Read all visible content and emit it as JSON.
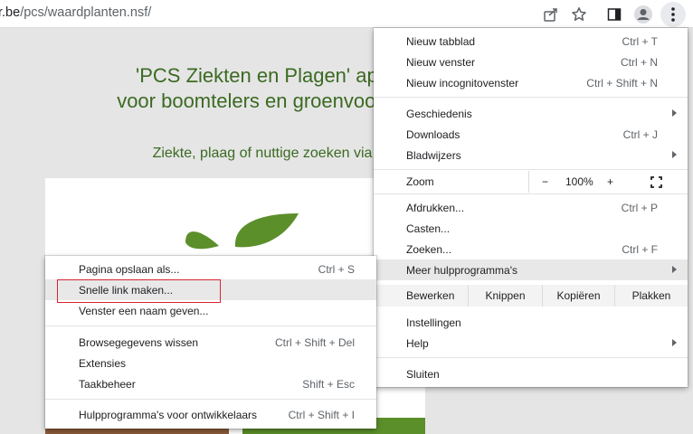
{
  "browser": {
    "url_domain": "r.be",
    "url_path": "/pcs/waardplanten.nsf/",
    "icons": [
      "share-icon",
      "bookmark-star-icon",
      "side-panel-icon",
      "profile-icon",
      "kebab-menu-icon"
    ]
  },
  "page": {
    "title_line1": "'PCS Ziekten en Plagen' app",
    "title_line2": "voor boomtelers en groenvoorzie",
    "subtitle": "Ziekte, plaag of nuttige zoeken via",
    "colors": {
      "title": "#3b6a22",
      "leaf": "#5b8f2a"
    }
  },
  "main_menu": {
    "new_tab": {
      "label": "Nieuw tabblad",
      "shortcut": "Ctrl + T"
    },
    "new_window": {
      "label": "Nieuw venster",
      "shortcut": "Ctrl + N"
    },
    "new_incognito": {
      "label": "Nieuw incognitovenster",
      "shortcut": "Ctrl + Shift + N"
    },
    "history": {
      "label": "Geschiedenis"
    },
    "downloads": {
      "label": "Downloads",
      "shortcut": "Ctrl + J"
    },
    "bookmarks": {
      "label": "Bladwijzers"
    },
    "zoom": {
      "label": "Zoom",
      "minus": "−",
      "value": "100%",
      "plus": "+"
    },
    "print": {
      "label": "Afdrukken...",
      "shortcut": "Ctrl + P"
    },
    "cast": {
      "label": "Casten..."
    },
    "find": {
      "label": "Zoeken...",
      "shortcut": "Ctrl + F"
    },
    "more_tools": {
      "label": "Meer hulpprogramma's"
    },
    "edit": {
      "label": "Bewerken",
      "cut": "Knippen",
      "copy": "Kopiëren",
      "paste": "Plakken"
    },
    "settings": {
      "label": "Instellingen"
    },
    "help": {
      "label": "Help"
    },
    "exit": {
      "label": "Sluiten"
    }
  },
  "sub_menu": {
    "save_page": {
      "label": "Pagina opslaan als...",
      "shortcut": "Ctrl + S"
    },
    "quick_link": {
      "label": "Snelle link maken..."
    },
    "name_window": {
      "label": "Venster een naam geven..."
    },
    "clear_data": {
      "label": "Browsegegevens wissen",
      "shortcut": "Ctrl + Shift + Del"
    },
    "extensions": {
      "label": "Extensies"
    },
    "task_manager": {
      "label": "Taakbeheer",
      "shortcut": "Shift + Esc"
    },
    "dev_tools": {
      "label": "Hulpprogramma's voor ontwikkelaars",
      "shortcut": "Ctrl + Shift + I"
    }
  }
}
